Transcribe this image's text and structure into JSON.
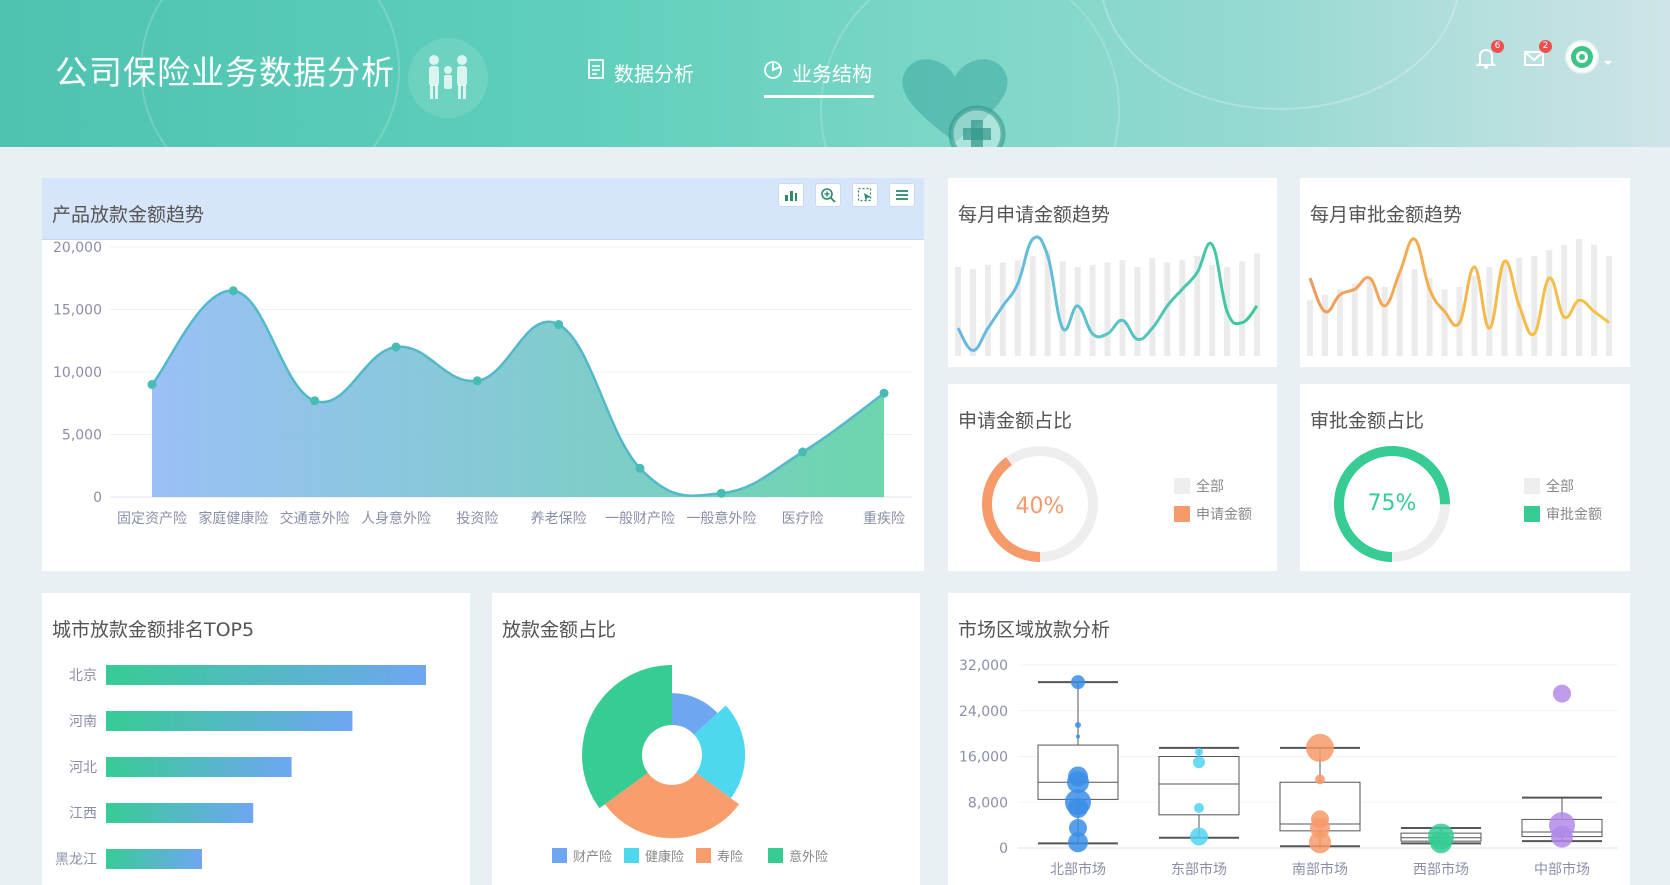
{
  "header": {
    "title": "公司保险业务数据分析",
    "tabs": [
      {
        "label": "数据分析",
        "icon": "report-icon",
        "active": false
      },
      {
        "label": "业务结构",
        "icon": "pie-chart-icon",
        "active": true
      }
    ],
    "notifications": {
      "count": "6"
    },
    "messages": {
      "count": "2"
    }
  },
  "panels": {
    "product_trend": {
      "title": "产品放款金额趋势"
    },
    "apply_trend": {
      "title": "每月申请金额趋势"
    },
    "approve_trend": {
      "title": "每月审批金额趋势"
    },
    "apply_ratio": {
      "title": "申请金额占比",
      "value_label": "40%",
      "legend": [
        "全部",
        "申请金额"
      ]
    },
    "approve_ratio": {
      "title": "审批金额占比",
      "value_label": "75%",
      "legend": [
        "全部",
        "审批金额"
      ]
    },
    "city_top5": {
      "title": "城市放款金额排名TOP5"
    },
    "loan_ratio": {
      "title": "放款金额占比"
    },
    "market": {
      "title": "市场区域放款分析"
    }
  },
  "colors": {
    "accent": "#3fc6a8",
    "area_left": "#8fb9f5",
    "area_right": "#5dd1a4",
    "apply_orange": "#f79a6a",
    "approve_green": "#36cc94"
  },
  "chart_data": [
    {
      "type": "area",
      "id": "product",
      "categories": [
        "固定资产险",
        "家庭健康险",
        "交通意外险",
        "人身意外险",
        "投资险",
        "养老保险",
        "一般财产险",
        "一般意外险",
        "医疗险",
        "重疾险"
      ],
      "values": [
        9000,
        16500,
        7700,
        12000,
        9300,
        13800,
        2300,
        300,
        3600,
        8300
      ],
      "ylim": [
        0,
        20000
      ],
      "yticks": [
        "20,000",
        "15,000",
        "10,000",
        "5,000",
        "0"
      ],
      "grid": true
    },
    {
      "type": "line",
      "id": "apply_trend",
      "values": [
        25,
        5,
        25,
        45,
        65,
        105,
        90,
        25,
        45,
        20,
        20,
        32,
        15,
        25,
        45,
        60,
        75,
        100,
        40,
        30,
        45
      ],
      "bars": [
        80,
        78,
        82,
        84,
        86,
        90,
        95,
        85,
        80,
        82,
        84,
        86,
        80,
        88,
        84,
        86,
        90,
        82,
        80,
        85,
        92
      ],
      "ylim": [
        0,
        115
      ],
      "grid": false
    },
    {
      "type": "line",
      "id": "approve_trend",
      "values": [
        70,
        40,
        55,
        60,
        70,
        45,
        75,
        105,
        60,
        40,
        30,
        80,
        25,
        85,
        45,
        20,
        70,
        35,
        50,
        40,
        30
      ],
      "bars": [
        50,
        55,
        60,
        65,
        70,
        62,
        75,
        78,
        70,
        60,
        62,
        72,
        80,
        85,
        88,
        90,
        95,
        100,
        105,
        100,
        90
      ],
      "ylim": [
        0,
        115
      ],
      "grid": false
    },
    {
      "type": "pie",
      "id": "apply_ratio",
      "values": [
        40,
        60
      ],
      "labels": [
        "申请金额",
        "全部"
      ]
    },
    {
      "type": "pie",
      "id": "approve_ratio",
      "values": [
        75,
        25
      ],
      "labels": [
        "审批金额",
        "全部"
      ]
    },
    {
      "type": "bar",
      "id": "city",
      "orientation": "horizontal",
      "categories": [
        "北京",
        "河南",
        "河北",
        "江西",
        "黑龙江"
      ],
      "values": [
        100,
        77,
        58,
        46,
        30
      ],
      "grid": false
    },
    {
      "type": "pie",
      "id": "loan_ratio",
      "variant": "rose",
      "categories": [
        "财产险",
        "健康险",
        "寿险",
        "意外险"
      ],
      "values": [
        15,
        25,
        34,
        40
      ],
      "colors": [
        "#6fa6f2",
        "#4dd8ef",
        "#f99d6c",
        "#37cc94"
      ]
    },
    {
      "type": "scatter",
      "id": "market",
      "variant": "boxplot",
      "categories": [
        "北部市场",
        "东部市场",
        "南部市场",
        "西部市场",
        "中部市场"
      ],
      "ylim": [
        0,
        32000
      ],
      "yticks": [
        "32,000",
        "24,000",
        "16,000",
        "8,000",
        "0"
      ],
      "boxes": [
        {
          "min": 800,
          "q1": 8500,
          "median": 11500,
          "q3": 18000,
          "max": 29000
        },
        {
          "min": 1800,
          "q1": 5800,
          "median": 11200,
          "q3": 16000,
          "max": 17500
        },
        {
          "min": 300,
          "q1": 3000,
          "median": 4200,
          "q3": 11500,
          "max": 17500
        },
        {
          "min": 800,
          "q1": 1200,
          "median": 1800,
          "q3": 2600,
          "max": 3500
        },
        {
          "min": 1200,
          "q1": 2000,
          "median": 2800,
          "q3": 5000,
          "max": 8800
        }
      ],
      "points": [
        {
          "g": 0,
          "v": 29000,
          "r": 7
        },
        {
          "g": 0,
          "v": 21500,
          "r": 3
        },
        {
          "g": 0,
          "v": 19500,
          "r": 2
        },
        {
          "g": 0,
          "v": 12500,
          "r": 10
        },
        {
          "g": 0,
          "v": 11500,
          "r": 11
        },
        {
          "g": 0,
          "v": 8000,
          "r": 13
        },
        {
          "g": 0,
          "v": 7000,
          "r": 10
        },
        {
          "g": 0,
          "v": 3500,
          "r": 9
        },
        {
          "g": 0,
          "v": 1000,
          "r": 10
        },
        {
          "g": 1,
          "v": 16800,
          "r": 4
        },
        {
          "g": 1,
          "v": 15000,
          "r": 6
        },
        {
          "g": 1,
          "v": 7000,
          "r": 5
        },
        {
          "g": 1,
          "v": 2000,
          "r": 9
        },
        {
          "g": 2,
          "v": 17500,
          "r": 14
        },
        {
          "g": 2,
          "v": 12000,
          "r": 5
        },
        {
          "g": 2,
          "v": 5000,
          "r": 9
        },
        {
          "g": 2,
          "v": 3500,
          "r": 10
        },
        {
          "g": 2,
          "v": 1000,
          "r": 11
        },
        {
          "g": 3,
          "v": 2000,
          "r": 13
        },
        {
          "g": 3,
          "v": 1000,
          "r": 11
        },
        {
          "g": 4,
          "v": 27000,
          "r": 9
        },
        {
          "g": 4,
          "v": 4000,
          "r": 13
        },
        {
          "g": 4,
          "v": 2000,
          "r": 11
        }
      ],
      "colors": [
        "#3a8ee6",
        "#52d4f0",
        "#f79a6a",
        "#36cc94",
        "#b389e8"
      ]
    }
  ]
}
